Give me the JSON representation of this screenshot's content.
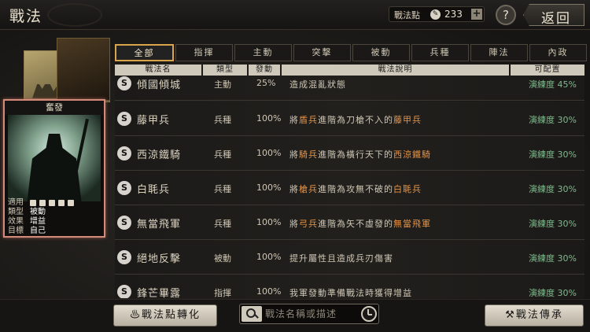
{
  "header": {
    "title": "戰法",
    "points_label": "戰法點",
    "points_value": "233",
    "plus": "+",
    "help": "?",
    "back": "返回"
  },
  "card": {
    "name": "奮發",
    "attrs": [
      {
        "key": "適用",
        "val": ""
      },
      {
        "key": "類型",
        "val": "被動"
      },
      {
        "key": "效果",
        "val": "增益"
      },
      {
        "key": "目標",
        "val": "自己"
      }
    ]
  },
  "tabs": [
    {
      "label": "全部",
      "active": true
    },
    {
      "label": "指揮"
    },
    {
      "label": "主動"
    },
    {
      "label": "突擊"
    },
    {
      "label": "被動"
    },
    {
      "label": "兵種"
    },
    {
      "label": "陣法"
    },
    {
      "label": "內政"
    }
  ],
  "table": {
    "headers": [
      "戰法名",
      "類型",
      "發動",
      "戰法說明",
      "可配置"
    ],
    "rows": [
      {
        "badge": "S",
        "name": "傾國傾城",
        "type": "主動",
        "pct": "25%",
        "desc": [
          "造成混亂狀態"
        ],
        "mastery": "演練度 45%"
      },
      {
        "badge": "S",
        "name": "藤甲兵",
        "type": "兵種",
        "pct": "100%",
        "desc": [
          "將",
          "盾兵",
          "進階為刀槍不入的",
          "藤甲兵"
        ],
        "mastery": "演練度 30%"
      },
      {
        "badge": "S",
        "name": "西涼鐵騎",
        "type": "兵種",
        "pct": "100%",
        "desc": [
          "將",
          "騎兵",
          "進階為橫行天下的",
          "西涼鐵騎"
        ],
        "mastery": "演練度 30%"
      },
      {
        "badge": "S",
        "name": "白毦兵",
        "type": "兵種",
        "pct": "100%",
        "desc": [
          "將",
          "槍兵",
          "進階為攻無不破的",
          "白毦兵"
        ],
        "mastery": "演練度 30%"
      },
      {
        "badge": "S",
        "name": "無當飛軍",
        "type": "兵種",
        "pct": "100%",
        "desc": [
          "將",
          "弓兵",
          "進階為矢不虛發的",
          "無當飛軍"
        ],
        "mastery": "演練度 30%"
      },
      {
        "badge": "S",
        "name": "絕地反擊",
        "type": "被動",
        "pct": "100%",
        "desc": [
          "提升屬性且造成兵刃傷害"
        ],
        "mastery": "演練度 30%"
      },
      {
        "badge": "S",
        "name": "鋒芒畢露",
        "type": "指揮",
        "pct": "100%",
        "desc": [
          "我軍發動準備戰法時獲得增益"
        ],
        "mastery": "演練度 30%"
      }
    ]
  },
  "bottom": {
    "convert": "戰法點轉化",
    "search_placeholder": "戰法名稱或描述",
    "inherit": "戰法傳承"
  }
}
